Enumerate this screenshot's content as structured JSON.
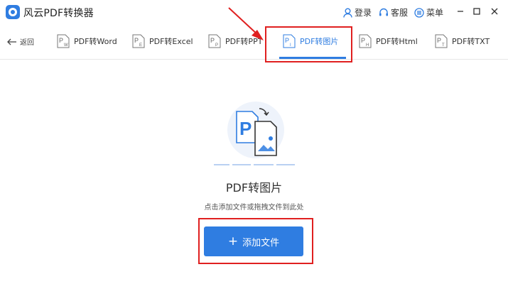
{
  "titlebar": {
    "app_title": "风云PDF转换器",
    "login_label": "登录",
    "service_label": "客服",
    "menu_label": "菜单"
  },
  "tabbar": {
    "back_label": "返回",
    "tabs": [
      {
        "label": "PDF转Word",
        "badge": "W"
      },
      {
        "label": "PDF转Excel",
        "badge": "E"
      },
      {
        "label": "PDF转PPT",
        "badge": "P"
      },
      {
        "label": "PDF转图片",
        "badge": "I",
        "active": true
      },
      {
        "label": "PDF转Html",
        "badge": "H"
      },
      {
        "label": "PDF转TXT",
        "badge": "T"
      }
    ]
  },
  "main": {
    "title": "PDF转图片",
    "hint": "点击添加文件或拖拽文件到此处",
    "add_button_label": "添加文件"
  },
  "colors": {
    "accent": "#2f7de1",
    "annotation": "#e02020"
  }
}
